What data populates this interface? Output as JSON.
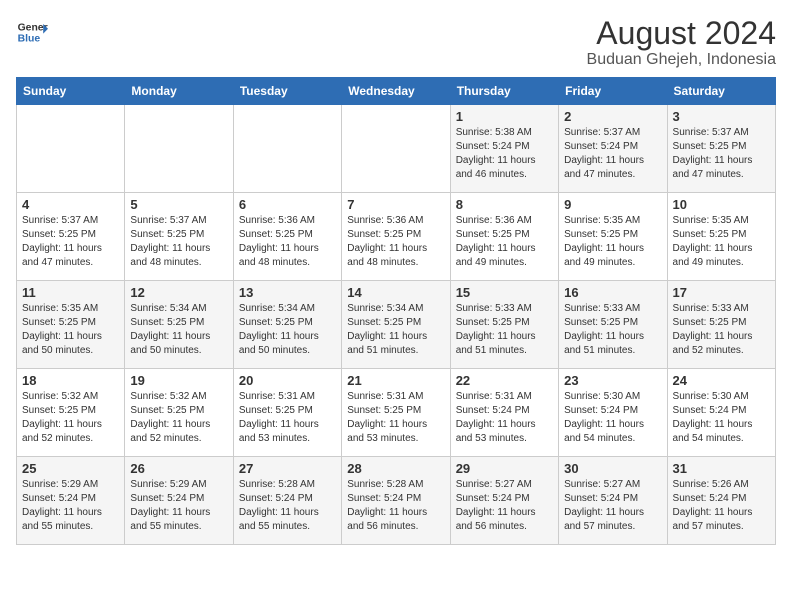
{
  "header": {
    "logo_line1": "General",
    "logo_line2": "Blue",
    "title": "August 2024",
    "subtitle": "Buduan Ghejeh, Indonesia"
  },
  "weekdays": [
    "Sunday",
    "Monday",
    "Tuesday",
    "Wednesday",
    "Thursday",
    "Friday",
    "Saturday"
  ],
  "weeks": [
    [
      {
        "day": "",
        "text": ""
      },
      {
        "day": "",
        "text": ""
      },
      {
        "day": "",
        "text": ""
      },
      {
        "day": "",
        "text": ""
      },
      {
        "day": "1",
        "text": "Sunrise: 5:38 AM\nSunset: 5:24 PM\nDaylight: 11 hours\nand 46 minutes."
      },
      {
        "day": "2",
        "text": "Sunrise: 5:37 AM\nSunset: 5:24 PM\nDaylight: 11 hours\nand 47 minutes."
      },
      {
        "day": "3",
        "text": "Sunrise: 5:37 AM\nSunset: 5:25 PM\nDaylight: 11 hours\nand 47 minutes."
      }
    ],
    [
      {
        "day": "4",
        "text": "Sunrise: 5:37 AM\nSunset: 5:25 PM\nDaylight: 11 hours\nand 47 minutes."
      },
      {
        "day": "5",
        "text": "Sunrise: 5:37 AM\nSunset: 5:25 PM\nDaylight: 11 hours\nand 48 minutes."
      },
      {
        "day": "6",
        "text": "Sunrise: 5:36 AM\nSunset: 5:25 PM\nDaylight: 11 hours\nand 48 minutes."
      },
      {
        "day": "7",
        "text": "Sunrise: 5:36 AM\nSunset: 5:25 PM\nDaylight: 11 hours\nand 48 minutes."
      },
      {
        "day": "8",
        "text": "Sunrise: 5:36 AM\nSunset: 5:25 PM\nDaylight: 11 hours\nand 49 minutes."
      },
      {
        "day": "9",
        "text": "Sunrise: 5:35 AM\nSunset: 5:25 PM\nDaylight: 11 hours\nand 49 minutes."
      },
      {
        "day": "10",
        "text": "Sunrise: 5:35 AM\nSunset: 5:25 PM\nDaylight: 11 hours\nand 49 minutes."
      }
    ],
    [
      {
        "day": "11",
        "text": "Sunrise: 5:35 AM\nSunset: 5:25 PM\nDaylight: 11 hours\nand 50 minutes."
      },
      {
        "day": "12",
        "text": "Sunrise: 5:34 AM\nSunset: 5:25 PM\nDaylight: 11 hours\nand 50 minutes."
      },
      {
        "day": "13",
        "text": "Sunrise: 5:34 AM\nSunset: 5:25 PM\nDaylight: 11 hours\nand 50 minutes."
      },
      {
        "day": "14",
        "text": "Sunrise: 5:34 AM\nSunset: 5:25 PM\nDaylight: 11 hours\nand 51 minutes."
      },
      {
        "day": "15",
        "text": "Sunrise: 5:33 AM\nSunset: 5:25 PM\nDaylight: 11 hours\nand 51 minutes."
      },
      {
        "day": "16",
        "text": "Sunrise: 5:33 AM\nSunset: 5:25 PM\nDaylight: 11 hours\nand 51 minutes."
      },
      {
        "day": "17",
        "text": "Sunrise: 5:33 AM\nSunset: 5:25 PM\nDaylight: 11 hours\nand 52 minutes."
      }
    ],
    [
      {
        "day": "18",
        "text": "Sunrise: 5:32 AM\nSunset: 5:25 PM\nDaylight: 11 hours\nand 52 minutes."
      },
      {
        "day": "19",
        "text": "Sunrise: 5:32 AM\nSunset: 5:25 PM\nDaylight: 11 hours\nand 52 minutes."
      },
      {
        "day": "20",
        "text": "Sunrise: 5:31 AM\nSunset: 5:25 PM\nDaylight: 11 hours\nand 53 minutes."
      },
      {
        "day": "21",
        "text": "Sunrise: 5:31 AM\nSunset: 5:25 PM\nDaylight: 11 hours\nand 53 minutes."
      },
      {
        "day": "22",
        "text": "Sunrise: 5:31 AM\nSunset: 5:24 PM\nDaylight: 11 hours\nand 53 minutes."
      },
      {
        "day": "23",
        "text": "Sunrise: 5:30 AM\nSunset: 5:24 PM\nDaylight: 11 hours\nand 54 minutes."
      },
      {
        "day": "24",
        "text": "Sunrise: 5:30 AM\nSunset: 5:24 PM\nDaylight: 11 hours\nand 54 minutes."
      }
    ],
    [
      {
        "day": "25",
        "text": "Sunrise: 5:29 AM\nSunset: 5:24 PM\nDaylight: 11 hours\nand 55 minutes."
      },
      {
        "day": "26",
        "text": "Sunrise: 5:29 AM\nSunset: 5:24 PM\nDaylight: 11 hours\nand 55 minutes."
      },
      {
        "day": "27",
        "text": "Sunrise: 5:28 AM\nSunset: 5:24 PM\nDaylight: 11 hours\nand 55 minutes."
      },
      {
        "day": "28",
        "text": "Sunrise: 5:28 AM\nSunset: 5:24 PM\nDaylight: 11 hours\nand 56 minutes."
      },
      {
        "day": "29",
        "text": "Sunrise: 5:27 AM\nSunset: 5:24 PM\nDaylight: 11 hours\nand 56 minutes."
      },
      {
        "day": "30",
        "text": "Sunrise: 5:27 AM\nSunset: 5:24 PM\nDaylight: 11 hours\nand 57 minutes."
      },
      {
        "day": "31",
        "text": "Sunrise: 5:26 AM\nSunset: 5:24 PM\nDaylight: 11 hours\nand 57 minutes."
      }
    ]
  ]
}
